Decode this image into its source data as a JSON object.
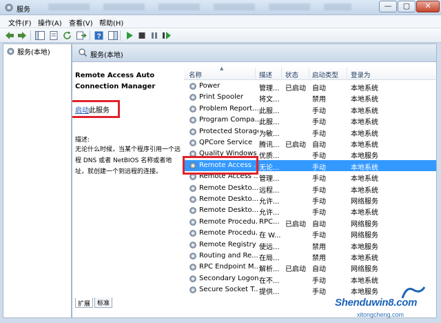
{
  "window": {
    "title": "服务",
    "controls": {
      "minimize": "—",
      "maximize": "▢",
      "close": "✕"
    }
  },
  "menu": [
    "文件(F)",
    "操作(A)",
    "查看(V)",
    "帮助(H)"
  ],
  "tree": {
    "root_label": "服务(本地)"
  },
  "panel": {
    "header_label": "服务(本地)",
    "service_name": "Remote Access Auto Connection Manager",
    "start_link": "启动",
    "start_suffix": "此服务",
    "description_label": "描述:",
    "description_text": "无论什么时候，当某个程序引用一个远程 DNS 或者 NetBIOS 名称或者地址，就创建一个到远程的连接。"
  },
  "columns": {
    "name": "名称",
    "description": "描述",
    "status": "状态",
    "startup": "启动类型",
    "logon": "登录为"
  },
  "services": [
    {
      "name": "Power",
      "description": "管理...",
      "status": "已启动",
      "startup": "自动",
      "logon": "本地系统"
    },
    {
      "name": "Print Spooler",
      "description": "将文...",
      "status": "",
      "startup": "禁用",
      "logon": "本地系统"
    },
    {
      "name": "Problem Report...",
      "description": "此服...",
      "status": "",
      "startup": "手动",
      "logon": "本地系统"
    },
    {
      "name": "Program Compa...",
      "description": "此服...",
      "status": "",
      "startup": "手动",
      "logon": "本地系统"
    },
    {
      "name": "Protected Storage",
      "description": "为敏...",
      "status": "",
      "startup": "手动",
      "logon": "本地系统"
    },
    {
      "name": "QPCore Service",
      "description": "腾讯...",
      "status": "已启动",
      "startup": "自动",
      "logon": "本地系统"
    },
    {
      "name": "Quality Windows ...",
      "description": "优质...",
      "status": "",
      "startup": "手动",
      "logon": "本地服务"
    },
    {
      "name": "Remote Access ...",
      "description": "无论...",
      "status": "",
      "startup": "手动",
      "logon": "本地系统"
    },
    {
      "name": "Remote Access ...",
      "description": "管理...",
      "status": "",
      "startup": "手动",
      "logon": "本地系统"
    },
    {
      "name": "Remote Deskto...",
      "description": "远程...",
      "status": "",
      "startup": "手动",
      "logon": "本地系统"
    },
    {
      "name": "Remote Deskto...",
      "description": "允许...",
      "status": "",
      "startup": "手动",
      "logon": "网络服务"
    },
    {
      "name": "Remote Deskto...",
      "description": "允许...",
      "status": "",
      "startup": "手动",
      "logon": "本地系统"
    },
    {
      "name": "Remote Procedu...",
      "description": "RPC...",
      "status": "已启动",
      "startup": "自动",
      "logon": "网络服务"
    },
    {
      "name": "Remote Procedu...",
      "description": "在 W...",
      "status": "",
      "startup": "手动",
      "logon": "网络服务"
    },
    {
      "name": "Remote Registry",
      "description": "使远...",
      "status": "",
      "startup": "禁用",
      "logon": "本地服务"
    },
    {
      "name": "Routing and Re...",
      "description": "在局...",
      "status": "",
      "startup": "禁用",
      "logon": "本地系统"
    },
    {
      "name": "RPC Endpoint M...",
      "description": "解析...",
      "status": "已启动",
      "startup": "自动",
      "logon": "网络服务"
    },
    {
      "name": "Secondary Logon",
      "description": "在不...",
      "status": "",
      "startup": "手动",
      "logon": "本地系统"
    },
    {
      "name": "Secure Socket T...",
      "description": "提供...",
      "status": "",
      "startup": "手动",
      "logon": "本地服务"
    }
  ],
  "selected_index": 7,
  "tabs": {
    "extended": "扩展",
    "standard": "标准"
  },
  "watermark": {
    "text": "Shenduwin8.com",
    "sub": "xitongcheng.com"
  },
  "colors": {
    "selection": "#3399ff",
    "highlight_box": "#e0222b",
    "link": "#1a56b7"
  }
}
